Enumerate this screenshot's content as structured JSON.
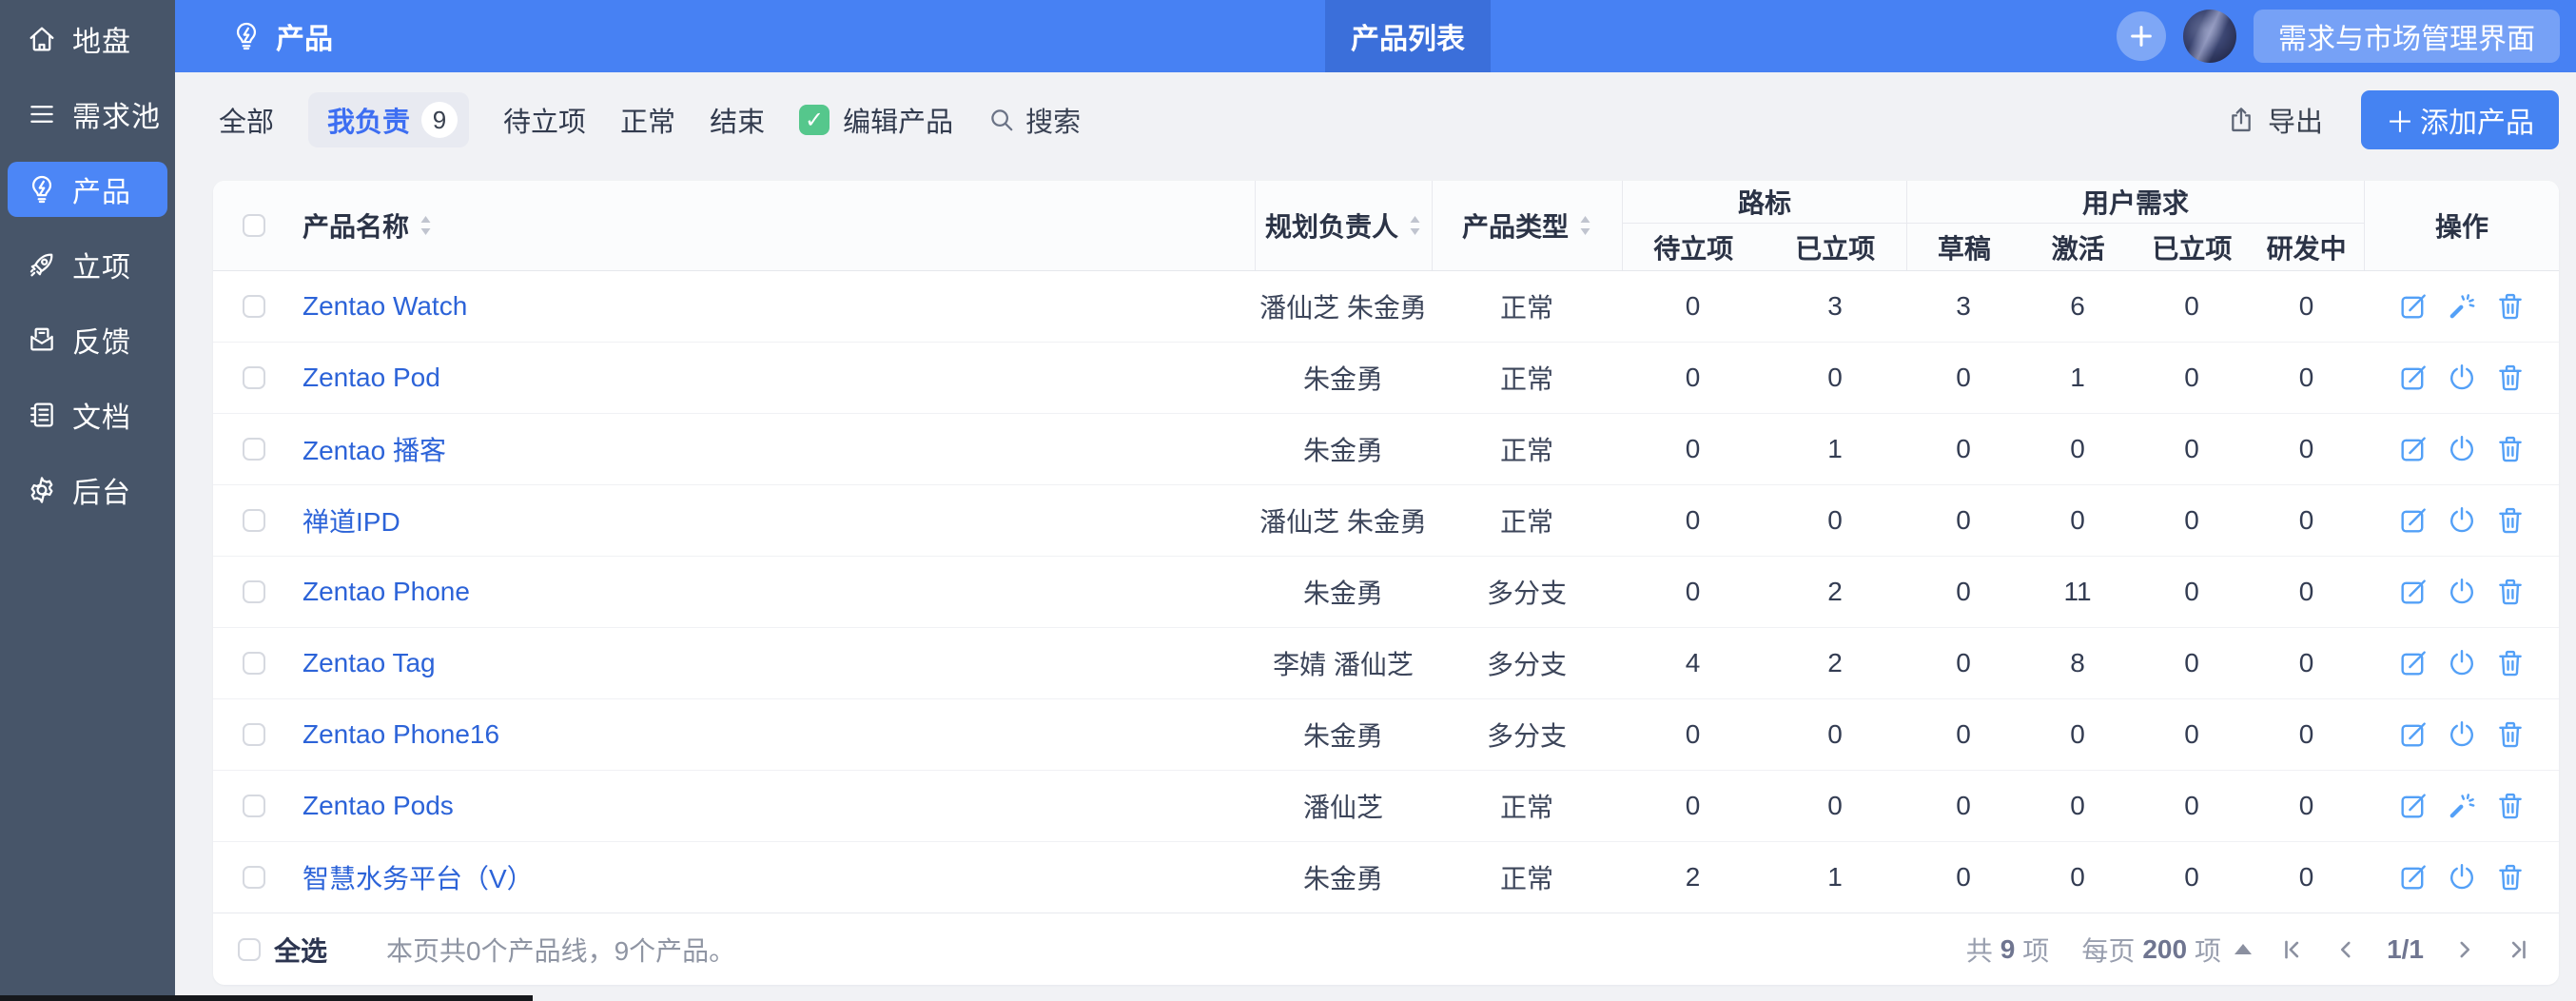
{
  "sidebar": {
    "items": [
      {
        "label": "地盘",
        "icon": "home-icon",
        "active": false
      },
      {
        "label": "需求池",
        "icon": "list-icon",
        "active": false
      },
      {
        "label": "产品",
        "icon": "bulb-icon",
        "active": true
      },
      {
        "label": "立项",
        "icon": "rocket-icon",
        "active": false
      },
      {
        "label": "反馈",
        "icon": "feedback-icon",
        "active": false
      },
      {
        "label": "文档",
        "icon": "document-icon",
        "active": false
      },
      {
        "label": "后台",
        "icon": "gear-icon",
        "active": false
      }
    ]
  },
  "header": {
    "title": "产品",
    "tab": "产品列表",
    "workspace_button": "需求与市场管理界面"
  },
  "toolbar": {
    "filter_all": "全部",
    "filter_mine": "我负责",
    "mine_count": "9",
    "filter_wait": "待立项",
    "filter_normal": "正常",
    "filter_closed": "结束",
    "edit_product": "编辑产品",
    "edit_check_glyph": "✓",
    "search": "搜索",
    "export": "导出",
    "add_plus": "＋",
    "add_product": "添加产品"
  },
  "table": {
    "headers": {
      "name": "产品名称",
      "owner": "规划负责人",
      "type": "产品类型",
      "roadmap_group": "路标",
      "roadmap_wait": "待立项",
      "roadmap_approved": "已立项",
      "story_group": "用户需求",
      "story_draft": "草稿",
      "story_active": "激活",
      "story_approved": "已立项",
      "story_developing": "研发中",
      "actions": "操作"
    },
    "rows": [
      {
        "name": "Zentao Watch",
        "owner": "潘仙芝 朱金勇",
        "type": "正常",
        "roadmap_wait": "0",
        "roadmap_approved": "3",
        "draft": "3",
        "active": "6",
        "approved": "0",
        "developing": "0",
        "middle_action": "wand"
      },
      {
        "name": "Zentao Pod",
        "owner": "朱金勇",
        "type": "正常",
        "roadmap_wait": "0",
        "roadmap_approved": "0",
        "draft": "0",
        "active": "1",
        "approved": "0",
        "developing": "0",
        "middle_action": "power"
      },
      {
        "name": "Zentao 播客",
        "owner": "朱金勇",
        "type": "正常",
        "roadmap_wait": "0",
        "roadmap_approved": "1",
        "draft": "0",
        "active": "0",
        "approved": "0",
        "developing": "0",
        "middle_action": "power"
      },
      {
        "name": "禅道IPD",
        "owner": "潘仙芝 朱金勇",
        "type": "正常",
        "roadmap_wait": "0",
        "roadmap_approved": "0",
        "draft": "0",
        "active": "0",
        "approved": "0",
        "developing": "0",
        "middle_action": "power"
      },
      {
        "name": "Zentao Phone",
        "owner": "朱金勇",
        "type": "多分支",
        "roadmap_wait": "0",
        "roadmap_approved": "2",
        "draft": "0",
        "active": "11",
        "approved": "0",
        "developing": "0",
        "middle_action": "power"
      },
      {
        "name": "Zentao Tag",
        "owner": "李婧 潘仙芝",
        "type": "多分支",
        "roadmap_wait": "4",
        "roadmap_approved": "2",
        "draft": "0",
        "active": "8",
        "approved": "0",
        "developing": "0",
        "middle_action": "power"
      },
      {
        "name": "Zentao Phone16",
        "owner": "朱金勇",
        "type": "多分支",
        "roadmap_wait": "0",
        "roadmap_approved": "0",
        "draft": "0",
        "active": "0",
        "approved": "0",
        "developing": "0",
        "middle_action": "power"
      },
      {
        "name": "Zentao Pods",
        "owner": "潘仙芝",
        "type": "正常",
        "roadmap_wait": "0",
        "roadmap_approved": "0",
        "draft": "0",
        "active": "0",
        "approved": "0",
        "developing": "0",
        "middle_action": "wand"
      },
      {
        "name": "智慧水务平台（V）",
        "owner": "朱金勇",
        "type": "正常",
        "roadmap_wait": "2",
        "roadmap_approved": "1",
        "draft": "0",
        "active": "0",
        "approved": "0",
        "developing": "0",
        "middle_action": "power"
      }
    ]
  },
  "footer": {
    "select_all": "全选",
    "summary": "本页共0个产品线，9个产品。",
    "total_prefix": "共",
    "total_count": "9",
    "total_suffix": "项",
    "perpage_prefix": "每页",
    "perpage_count": "200",
    "perpage_suffix": "项",
    "page_indicator": "1/1"
  },
  "colors": {
    "topbar_blue": "#4781f3",
    "tab_blue": "#3b6fda",
    "sidebar_slate": "#475569",
    "active_item_blue": "#4c86f6",
    "link_blue": "#2c63d8",
    "action_icon_blue": "#53a0f7",
    "add_button_blue": "#4583f2",
    "green_check": "#55c78c"
  }
}
